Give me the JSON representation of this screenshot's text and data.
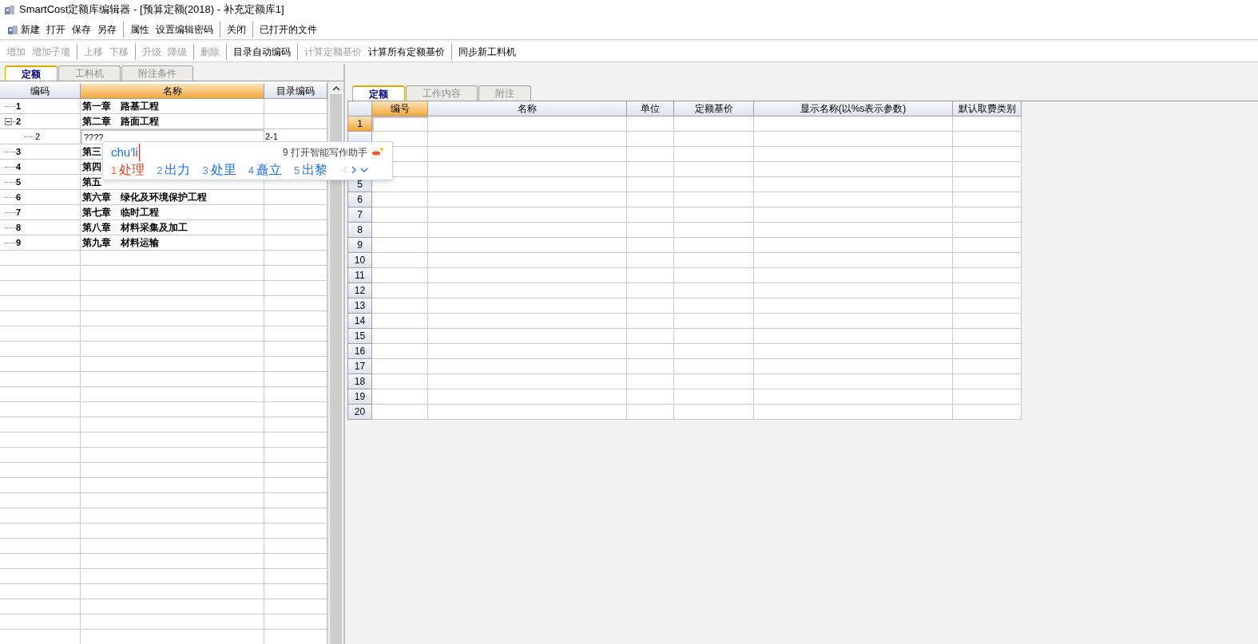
{
  "window": {
    "title": "SmartCost定额库编辑器 - [预算定额(2018) - 补充定额库1]"
  },
  "menu_toolbar": [
    [
      {
        "label": "新建",
        "kind": "icon"
      },
      {
        "label": "打开"
      },
      {
        "label": "保存"
      },
      {
        "label": "另存"
      }
    ],
    [
      {
        "label": "属性"
      },
      {
        "label": "设置编辑密码"
      }
    ],
    [
      {
        "label": "关闭"
      }
    ],
    [
      {
        "label": "已打开的文件"
      }
    ]
  ],
  "edit_toolbar": [
    [
      {
        "label": "增加",
        "disabled": true
      },
      {
        "label": "增加子项",
        "disabled": true
      }
    ],
    [
      {
        "label": "上移",
        "disabled": true
      },
      {
        "label": "下移",
        "disabled": true
      }
    ],
    [
      {
        "label": "升级",
        "disabled": true
      },
      {
        "label": "降级",
        "disabled": true
      }
    ],
    [
      {
        "label": "删除",
        "disabled": true
      }
    ],
    [
      {
        "label": "目录自动编码",
        "disabled": false
      }
    ],
    [
      {
        "label": "计算定额基价",
        "disabled": true
      },
      {
        "label": "计算所有定额基价",
        "disabled": false
      }
    ],
    [
      {
        "label": "同步新工料机",
        "disabled": false
      }
    ]
  ],
  "left_tabs": [
    {
      "label": "定额",
      "selected": true
    },
    {
      "label": "工料机",
      "selected": false
    },
    {
      "label": "附注条件",
      "selected": false
    }
  ],
  "tree": {
    "columns": [
      {
        "label": "编码",
        "selected": false
      },
      {
        "label": "名称",
        "selected": true
      },
      {
        "label": "目录编码",
        "selected": false
      }
    ],
    "rows": [
      {
        "code": "1",
        "name": "第一章　路基工程"
      },
      {
        "code": "2",
        "name": "第二章　路面工程",
        "expanded": true,
        "children": [
          {
            "code": "2",
            "name": "????",
            "dir_code": "2-1",
            "editing": true
          }
        ]
      },
      {
        "code": "3",
        "name": "第三"
      },
      {
        "code": "4",
        "name": "第四"
      },
      {
        "code": "5",
        "name": "第五"
      },
      {
        "code": "6",
        "name": "第六章　绿化及环境保护工程"
      },
      {
        "code": "7",
        "name": "第七章　临时工程"
      },
      {
        "code": "8",
        "name": "第八章　材料采集及加工"
      },
      {
        "code": "9",
        "name": "第九章　材料运输"
      }
    ]
  },
  "right_tabs": [
    {
      "label": "定额",
      "selected": true
    },
    {
      "label": "工作内容",
      "selected": false
    },
    {
      "label": "附注",
      "selected": false
    }
  ],
  "quota_table": {
    "columns": [
      {
        "label": "编号",
        "selected": true
      },
      {
        "label": "名称",
        "selected": false
      },
      {
        "label": "单位",
        "selected": false
      },
      {
        "label": "定额基价",
        "selected": false
      },
      {
        "label": "显示名称(以%s表示参数)",
        "selected": false
      },
      {
        "label": "默认取费类别",
        "selected": false
      }
    ],
    "rows": [
      {
        "number": "1",
        "selected": true
      },
      {
        "selected": false
      },
      {},
      {},
      {
        "number": "5",
        "selected": false
      },
      {
        "number": "6",
        "selected": false
      },
      {
        "number": "7",
        "selected": false
      },
      {
        "number": "8",
        "selected": false
      },
      {
        "number": "9",
        "selected": false
      },
      {
        "number": "10",
        "selected": false
      },
      {
        "number": "11",
        "selected": false
      },
      {
        "number": "12",
        "selected": false
      },
      {
        "number": "13",
        "selected": false
      },
      {
        "number": "14",
        "selected": false
      },
      {
        "number": "15",
        "selected": false
      },
      {
        "number": "16",
        "selected": false
      },
      {
        "number": "17",
        "selected": false
      },
      {
        "number": "18",
        "selected": false
      },
      {
        "number": "19",
        "selected": false
      },
      {
        "number": "20",
        "selected": false
      }
    ]
  },
  "ime": {
    "composition": "chu'li",
    "assistant": "9 打开智能写作助手",
    "candidates": [
      {
        "index": "1",
        "text": "处理",
        "selected": true
      },
      {
        "index": "2",
        "text": "出力",
        "selected": false
      },
      {
        "index": "3",
        "text": "处里",
        "selected": false
      },
      {
        "index": "4",
        "text": "矗立",
        "selected": false
      },
      {
        "index": "5",
        "text": "出黎",
        "selected": false
      }
    ]
  }
}
